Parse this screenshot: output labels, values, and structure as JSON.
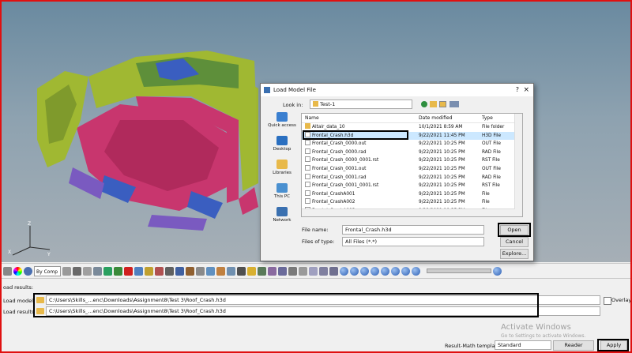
{
  "viewport": {
    "axis_labels": {
      "x": "X",
      "y": "Y",
      "z": "Z"
    }
  },
  "toolbar": {
    "by_comp_label": "By Comp"
  },
  "panel": {
    "section_label": "oad results:",
    "load_model_label": "Load model",
    "load_model_value": "C:\\Users\\Skills_...enc\\Downloads\\Assignment8\\Test 3\\Roof_Crash.h3d",
    "load_results_label": "Load results",
    "load_results_value": "C:\\Users\\Skills_...enc\\Downloads\\Assignment8\\Test 3\\Roof_Crash.h3d",
    "overlay_label": "Overlay",
    "result_math_label": "Result-Math template:",
    "template_value": "Standard",
    "reader_options_label": "Reader Options...",
    "apply_label": "Apply"
  },
  "watermark": {
    "line1": "Activate Windows",
    "line2": "Go to Settings to activate Windows."
  },
  "dialog": {
    "title": "Load Model File",
    "look_in_label": "Look in:",
    "look_in_value": "Test-1",
    "places": [
      "Quick access",
      "Desktop",
      "Libraries",
      "This PC",
      "Network"
    ],
    "columns": {
      "name": "Name",
      "date": "Date modified",
      "type": "Type"
    },
    "files": [
      {
        "name": "Altair_data_10",
        "date": "10/1/2021 8:59 AM",
        "type": "File folder",
        "kind": "folder"
      },
      {
        "name": "Frontal_Crash.h3d",
        "date": "9/22/2021 11:45 PM",
        "type": "H3D File",
        "kind": "file"
      },
      {
        "name": "Frontal_Crash_0000.out",
        "date": "9/22/2021 10:25 PM",
        "type": "OUT File",
        "kind": "file"
      },
      {
        "name": "Frontal_Crash_0000.rad",
        "date": "9/22/2021 10:25 PM",
        "type": "RAD File",
        "kind": "file"
      },
      {
        "name": "Frontal_Crash_0000_0001.rst",
        "date": "9/22/2021 10:25 PM",
        "type": "RST File",
        "kind": "file"
      },
      {
        "name": "Frontal_Crash_0001.out",
        "date": "9/22/2021 10:25 PM",
        "type": "OUT File",
        "kind": "file"
      },
      {
        "name": "Frontal_Crash_0001.rad",
        "date": "9/22/2021 10:25 PM",
        "type": "RAD File",
        "kind": "file"
      },
      {
        "name": "Frontal_Crash_0001_0001.rst",
        "date": "9/22/2021 10:25 PM",
        "type": "RST File",
        "kind": "file"
      },
      {
        "name": "Frontal_CrashA001",
        "date": "9/22/2021 10:25 PM",
        "type": "File",
        "kind": "file"
      },
      {
        "name": "Frontal_CrashA002",
        "date": "9/22/2021 10:25 PM",
        "type": "File",
        "kind": "file"
      },
      {
        "name": "Frontal_CrashA003",
        "date": "9/22/2021 10:35 PM",
        "type": "File",
        "kind": "file"
      }
    ],
    "file_name_label": "File name:",
    "file_name_value": "Frontal_Crash.h3d",
    "file_type_label": "Files of type:",
    "file_type_value": "All Files (*.*)",
    "open_label": "Open",
    "cancel_label": "Cancel",
    "explore_label": "Explore..."
  },
  "colors": {
    "highlight_frame": "#e01010",
    "selected_row": "#cce8ff",
    "car_pink": "#c8366e",
    "car_green": "#a0b832",
    "car_blue": "#3a5ec0",
    "car_purple": "#7a5ac0"
  }
}
